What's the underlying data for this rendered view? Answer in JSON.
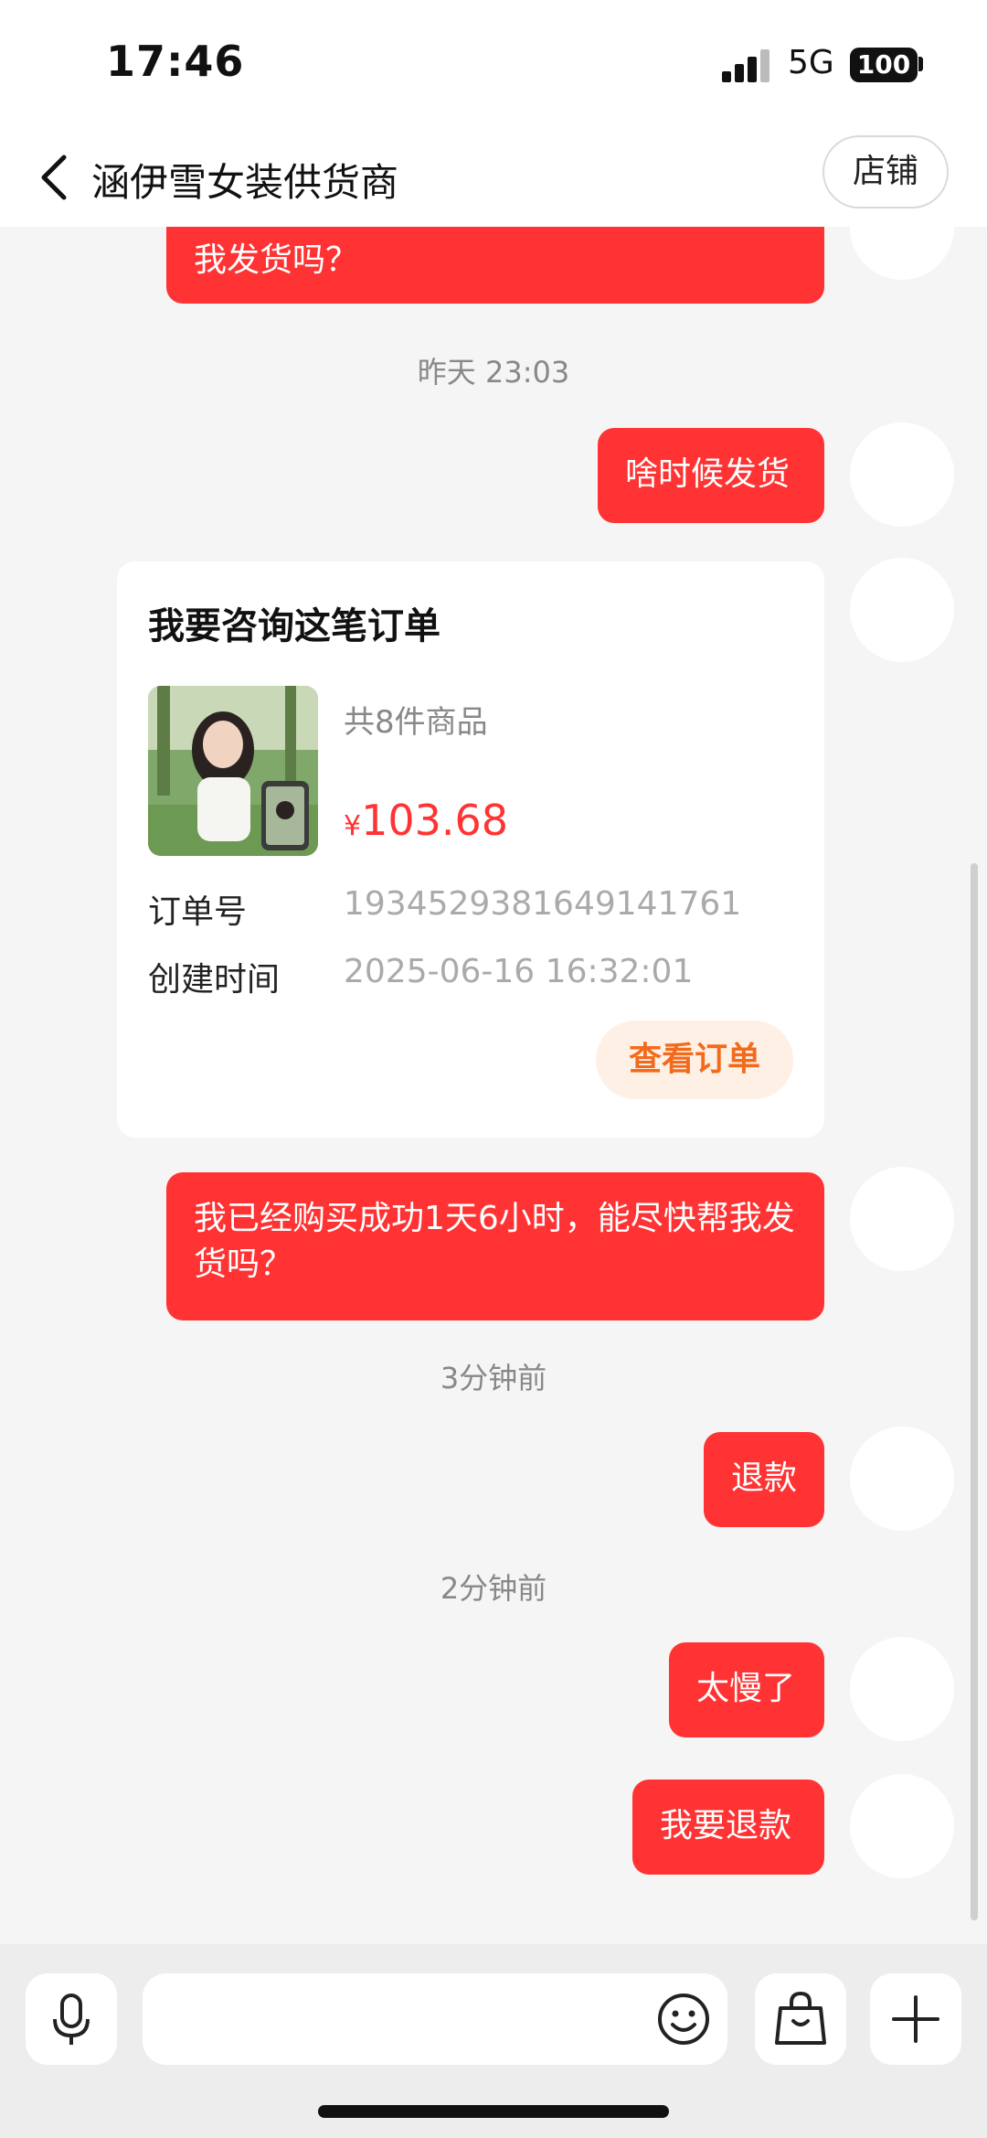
{
  "status_bar": {
    "time": "17:46",
    "network": "5G",
    "battery": "100"
  },
  "header": {
    "title": "涵伊雪女装供货商",
    "shop_button": "店铺"
  },
  "messages": {
    "partial_text": "我已经购买成功1天6小时，能尽快帮我发货吗？",
    "partial_text_visible": "我发货吗？",
    "stamp_yesterday": "昨天 23:03",
    "msg_when_ship": "啥时候发货",
    "msg_rush": "我已经购买成功1天6小时，能尽快帮我发货吗？",
    "stamp_3min": "3分钟前",
    "msg_refund": "退款",
    "stamp_2min": "2分钟前",
    "msg_too_slow": "太慢了",
    "msg_want_refund": "我要退款"
  },
  "order_card": {
    "title": "我要咨询这笔订单",
    "item_count": "共8件商品",
    "currency": "¥",
    "price": "103.68",
    "order_no_label": "订单号",
    "order_no": "1934529381649141761",
    "created_label": "创建时间",
    "created_at": "2025-06-16 16:32:01",
    "view_button": "查看订单"
  },
  "input_bar": {
    "placeholder": ""
  },
  "colors": {
    "accent": "#ff3333",
    "button_orange": "#f26b1d",
    "button_orange_bg": "#fff0e6",
    "background": "#f5f5f5"
  },
  "icons": [
    "back-icon",
    "microphone-icon",
    "emoji-icon",
    "shopping-bag-icon",
    "plus-icon"
  ]
}
